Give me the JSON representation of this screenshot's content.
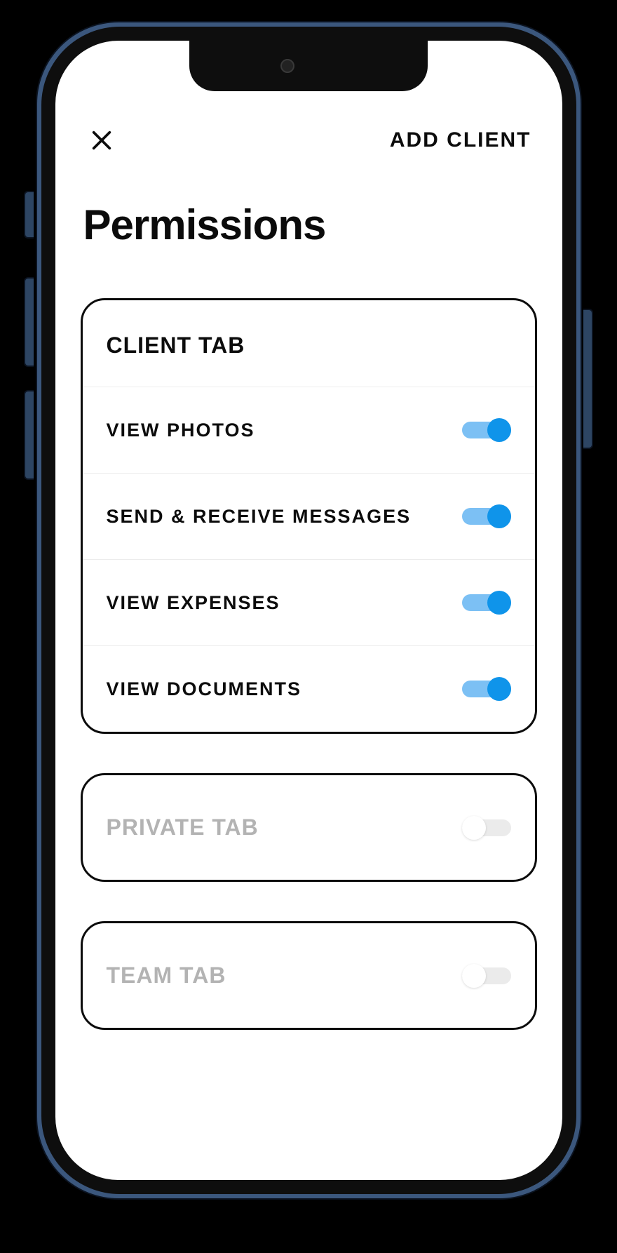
{
  "header": {
    "action_label": "ADD CLIENT"
  },
  "page": {
    "title": "Permissions"
  },
  "groups": [
    {
      "title": "CLIENT TAB",
      "dim": false,
      "toggle": null,
      "items": [
        {
          "label": "VIEW PHOTOS",
          "enabled": true
        },
        {
          "label": "SEND & RECEIVE MESSAGES",
          "enabled": true
        },
        {
          "label": "VIEW EXPENSES",
          "enabled": true
        },
        {
          "label": "VIEW DOCUMENTS",
          "enabled": true
        }
      ]
    },
    {
      "title": "PRIVATE TAB",
      "dim": true,
      "toggle": {
        "enabled": false
      },
      "items": []
    },
    {
      "title": "TEAM TAB",
      "dim": true,
      "toggle": {
        "enabled": false
      },
      "items": []
    }
  ],
  "colors": {
    "toggle_on_track": "#7cc0f4",
    "toggle_on_knob": "#0f94ea",
    "toggle_off_track": "#ebebeb",
    "toggle_off_knob": "#ffffff"
  }
}
